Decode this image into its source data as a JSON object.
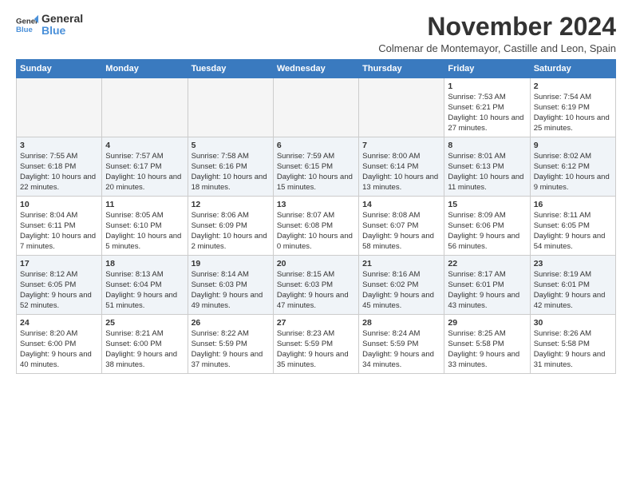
{
  "logo": {
    "line1": "General",
    "line2": "Blue"
  },
  "title": "November 2024",
  "subtitle": "Colmenar de Montemayor, Castille and Leon, Spain",
  "weekdays": [
    "Sunday",
    "Monday",
    "Tuesday",
    "Wednesday",
    "Thursday",
    "Friday",
    "Saturday"
  ],
  "weeks": [
    [
      {
        "day": "",
        "info": ""
      },
      {
        "day": "",
        "info": ""
      },
      {
        "day": "",
        "info": ""
      },
      {
        "day": "",
        "info": ""
      },
      {
        "day": "",
        "info": ""
      },
      {
        "day": "1",
        "info": "Sunrise: 7:53 AM\nSunset: 6:21 PM\nDaylight: 10 hours and 27 minutes."
      },
      {
        "day": "2",
        "info": "Sunrise: 7:54 AM\nSunset: 6:19 PM\nDaylight: 10 hours and 25 minutes."
      }
    ],
    [
      {
        "day": "3",
        "info": "Sunrise: 7:55 AM\nSunset: 6:18 PM\nDaylight: 10 hours and 22 minutes."
      },
      {
        "day": "4",
        "info": "Sunrise: 7:57 AM\nSunset: 6:17 PM\nDaylight: 10 hours and 20 minutes."
      },
      {
        "day": "5",
        "info": "Sunrise: 7:58 AM\nSunset: 6:16 PM\nDaylight: 10 hours and 18 minutes."
      },
      {
        "day": "6",
        "info": "Sunrise: 7:59 AM\nSunset: 6:15 PM\nDaylight: 10 hours and 15 minutes."
      },
      {
        "day": "7",
        "info": "Sunrise: 8:00 AM\nSunset: 6:14 PM\nDaylight: 10 hours and 13 minutes."
      },
      {
        "day": "8",
        "info": "Sunrise: 8:01 AM\nSunset: 6:13 PM\nDaylight: 10 hours and 11 minutes."
      },
      {
        "day": "9",
        "info": "Sunrise: 8:02 AM\nSunset: 6:12 PM\nDaylight: 10 hours and 9 minutes."
      }
    ],
    [
      {
        "day": "10",
        "info": "Sunrise: 8:04 AM\nSunset: 6:11 PM\nDaylight: 10 hours and 7 minutes."
      },
      {
        "day": "11",
        "info": "Sunrise: 8:05 AM\nSunset: 6:10 PM\nDaylight: 10 hours and 5 minutes."
      },
      {
        "day": "12",
        "info": "Sunrise: 8:06 AM\nSunset: 6:09 PM\nDaylight: 10 hours and 2 minutes."
      },
      {
        "day": "13",
        "info": "Sunrise: 8:07 AM\nSunset: 6:08 PM\nDaylight: 10 hours and 0 minutes."
      },
      {
        "day": "14",
        "info": "Sunrise: 8:08 AM\nSunset: 6:07 PM\nDaylight: 9 hours and 58 minutes."
      },
      {
        "day": "15",
        "info": "Sunrise: 8:09 AM\nSunset: 6:06 PM\nDaylight: 9 hours and 56 minutes."
      },
      {
        "day": "16",
        "info": "Sunrise: 8:11 AM\nSunset: 6:05 PM\nDaylight: 9 hours and 54 minutes."
      }
    ],
    [
      {
        "day": "17",
        "info": "Sunrise: 8:12 AM\nSunset: 6:05 PM\nDaylight: 9 hours and 52 minutes."
      },
      {
        "day": "18",
        "info": "Sunrise: 8:13 AM\nSunset: 6:04 PM\nDaylight: 9 hours and 51 minutes."
      },
      {
        "day": "19",
        "info": "Sunrise: 8:14 AM\nSunset: 6:03 PM\nDaylight: 9 hours and 49 minutes."
      },
      {
        "day": "20",
        "info": "Sunrise: 8:15 AM\nSunset: 6:03 PM\nDaylight: 9 hours and 47 minutes."
      },
      {
        "day": "21",
        "info": "Sunrise: 8:16 AM\nSunset: 6:02 PM\nDaylight: 9 hours and 45 minutes."
      },
      {
        "day": "22",
        "info": "Sunrise: 8:17 AM\nSunset: 6:01 PM\nDaylight: 9 hours and 43 minutes."
      },
      {
        "day": "23",
        "info": "Sunrise: 8:19 AM\nSunset: 6:01 PM\nDaylight: 9 hours and 42 minutes."
      }
    ],
    [
      {
        "day": "24",
        "info": "Sunrise: 8:20 AM\nSunset: 6:00 PM\nDaylight: 9 hours and 40 minutes."
      },
      {
        "day": "25",
        "info": "Sunrise: 8:21 AM\nSunset: 6:00 PM\nDaylight: 9 hours and 38 minutes."
      },
      {
        "day": "26",
        "info": "Sunrise: 8:22 AM\nSunset: 5:59 PM\nDaylight: 9 hours and 37 minutes."
      },
      {
        "day": "27",
        "info": "Sunrise: 8:23 AM\nSunset: 5:59 PM\nDaylight: 9 hours and 35 minutes."
      },
      {
        "day": "28",
        "info": "Sunrise: 8:24 AM\nSunset: 5:59 PM\nDaylight: 9 hours and 34 minutes."
      },
      {
        "day": "29",
        "info": "Sunrise: 8:25 AM\nSunset: 5:58 PM\nDaylight: 9 hours and 33 minutes."
      },
      {
        "day": "30",
        "info": "Sunrise: 8:26 AM\nSunset: 5:58 PM\nDaylight: 9 hours and 31 minutes."
      }
    ]
  ]
}
